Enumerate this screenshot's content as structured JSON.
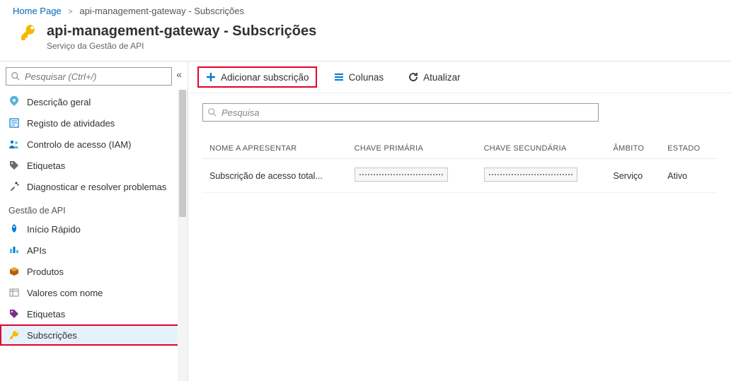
{
  "breadcrumb": {
    "home": "Home Page",
    "resource": "api-management-gateway - Subscrições"
  },
  "header": {
    "title": "api-management-gateway - Subscrições",
    "subtitle": "Serviço da Gestão de API"
  },
  "sidebar": {
    "search_placeholder": "Pesquisar (Ctrl+/)",
    "items_top": [
      {
        "icon": "overview",
        "label": "Descrição geral"
      },
      {
        "icon": "activity",
        "label": "Registo de atividades"
      },
      {
        "icon": "iam",
        "label": "Controlo de acesso (IAM)"
      },
      {
        "icon": "tags",
        "label": "Etiquetas"
      },
      {
        "icon": "diagnose",
        "label": "Diagnosticar e resolver problemas"
      }
    ],
    "section1_label": "Gestão de API",
    "items_api": [
      {
        "icon": "rocket",
        "label": "Início Rápido"
      },
      {
        "icon": "apis",
        "label": "APIs"
      },
      {
        "icon": "products",
        "label": "Produtos"
      },
      {
        "icon": "namedvalues",
        "label": "Valores com nome"
      },
      {
        "icon": "tags",
        "label": "Etiquetas"
      },
      {
        "icon": "key",
        "label": "Subscrições"
      }
    ]
  },
  "toolbar": {
    "add_label": "Adicionar subscrição",
    "columns_label": "Colunas",
    "refresh_label": "Atualizar"
  },
  "content": {
    "search_placeholder": "Pesquisa",
    "columns": {
      "name": "NOME A APRESENTAR",
      "primary": "CHAVE PRIMÁRIA",
      "secondary": "CHAVE SECUNDÁRIA",
      "scope": "ÂMBITO",
      "state": "ESTADO"
    },
    "rows": [
      {
        "name": "Subscrição de acesso total...",
        "scope": "Serviço",
        "state": "Ativo"
      }
    ]
  }
}
